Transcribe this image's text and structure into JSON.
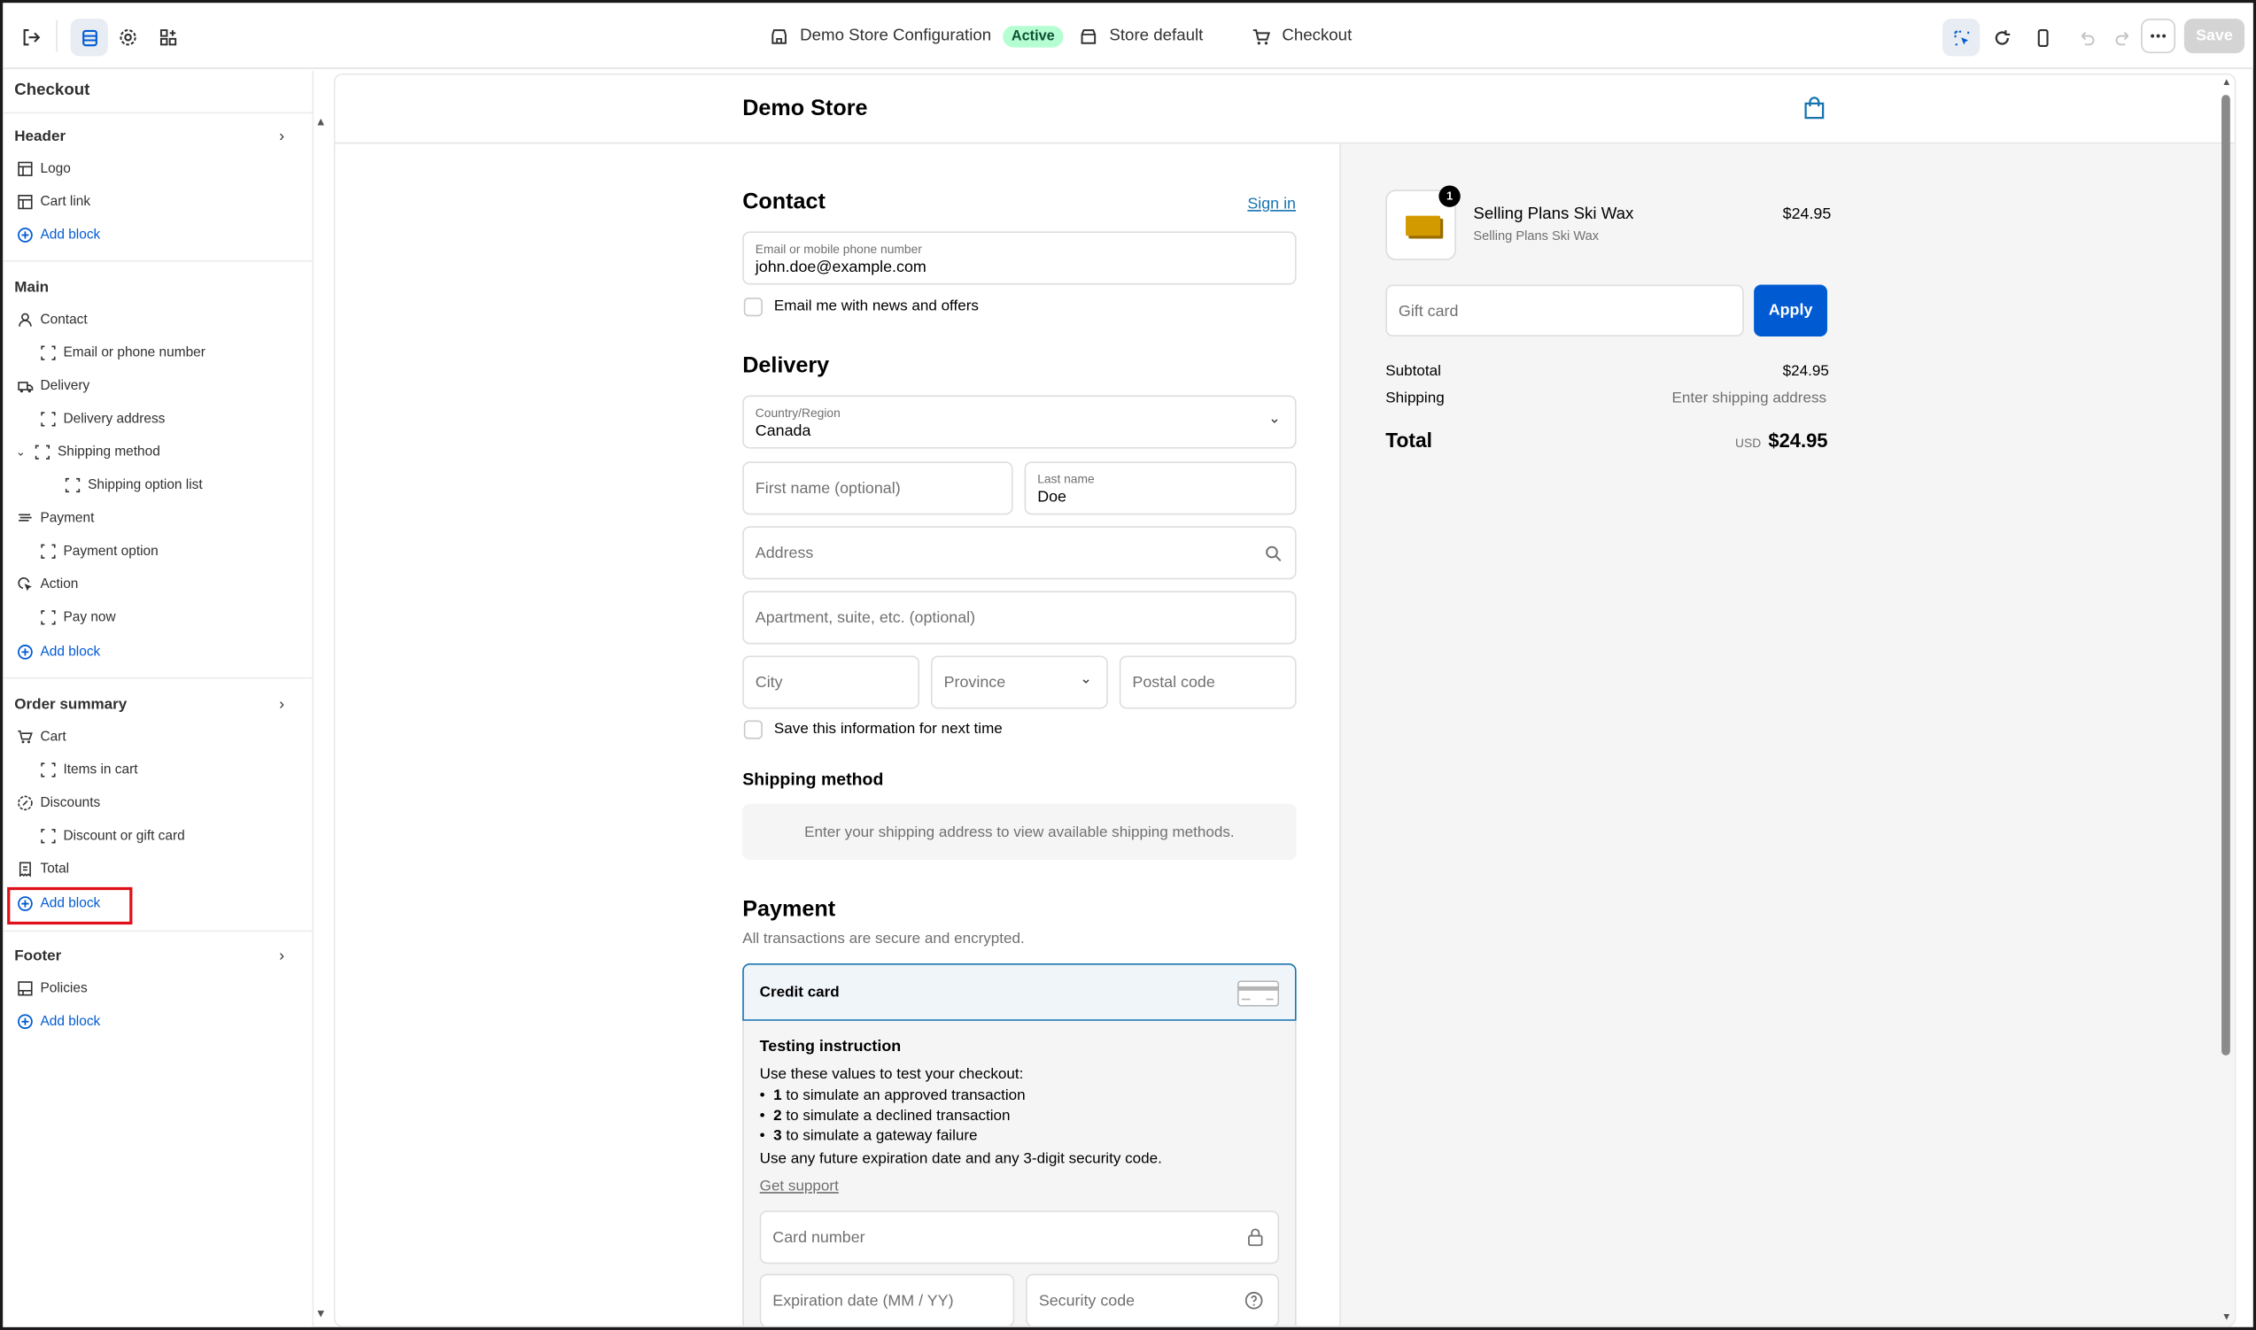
{
  "topbar": {
    "config_name": "Demo Store Configuration",
    "status": "Active",
    "store_default": "Store default",
    "checkout": "Checkout",
    "save_label": "Save"
  },
  "sidebar": {
    "title": "Checkout",
    "sections": {
      "header": {
        "title": "Header",
        "items": [
          "Logo",
          "Cart link"
        ],
        "add": "Add block"
      },
      "main": {
        "title": "Main",
        "items": [
          "Contact",
          "Email or phone number",
          "Delivery",
          "Delivery address",
          "Shipping method",
          "Shipping option list",
          "Payment",
          "Payment option",
          "Action",
          "Pay now"
        ],
        "add": "Add block"
      },
      "order_summary": {
        "title": "Order summary",
        "items": [
          "Cart",
          "Items in cart",
          "Discounts",
          "Discount or gift card",
          "Total"
        ],
        "add": "Add block"
      },
      "footer": {
        "title": "Footer",
        "items": [
          "Policies"
        ],
        "add": "Add block"
      }
    }
  },
  "preview": {
    "store_name": "Demo Store",
    "contact": {
      "title": "Contact",
      "sign_in": "Sign in",
      "email_label": "Email or mobile phone number",
      "email_value": "john.doe@example.com",
      "newsletter": "Email me with news and offers"
    },
    "delivery": {
      "title": "Delivery",
      "country_label": "Country/Region",
      "country_value": "Canada",
      "first_name_ph": "First name (optional)",
      "last_name_label": "Last name",
      "last_name_value": "Doe",
      "address_ph": "Address",
      "apartment_ph": "Apartment, suite, etc. (optional)",
      "city_ph": "City",
      "province_ph": "Province",
      "postal_ph": "Postal code",
      "save_info": "Save this information for next time"
    },
    "shipping_method": {
      "title": "Shipping method",
      "note": "Enter your shipping address to view available shipping methods."
    },
    "payment": {
      "title": "Payment",
      "subtitle": "All transactions are secure and encrypted.",
      "method": "Credit card",
      "testing_title": "Testing instruction",
      "testing_intro": "Use these values to test your checkout:",
      "test_values": [
        {
          "num": "1",
          "text": "to simulate an approved transaction"
        },
        {
          "num": "2",
          "text": "to simulate a declined transaction"
        },
        {
          "num": "3",
          "text": "to simulate a gateway failure"
        }
      ],
      "testing_outro": "Use any future expiration date and any 3-digit security code.",
      "support": "Get support",
      "card_number_ph": "Card number",
      "expiry_ph": "Expiration date (MM / YY)",
      "security_ph": "Security code"
    },
    "summary": {
      "product_name": "Selling Plans Ski Wax",
      "product_variant": "Selling Plans Ski Wax",
      "product_price": "$24.95",
      "quantity": "1",
      "gift_card_ph": "Gift card",
      "apply": "Apply",
      "subtotal_label": "Subtotal",
      "subtotal_value": "$24.95",
      "shipping_label": "Shipping",
      "shipping_value": "Enter shipping address",
      "total_label": "Total",
      "currency": "USD",
      "total_value": "$24.95"
    }
  },
  "colors": {
    "accent": "#005bd3",
    "link": "#1773b0",
    "highlight": "#e0101a"
  }
}
